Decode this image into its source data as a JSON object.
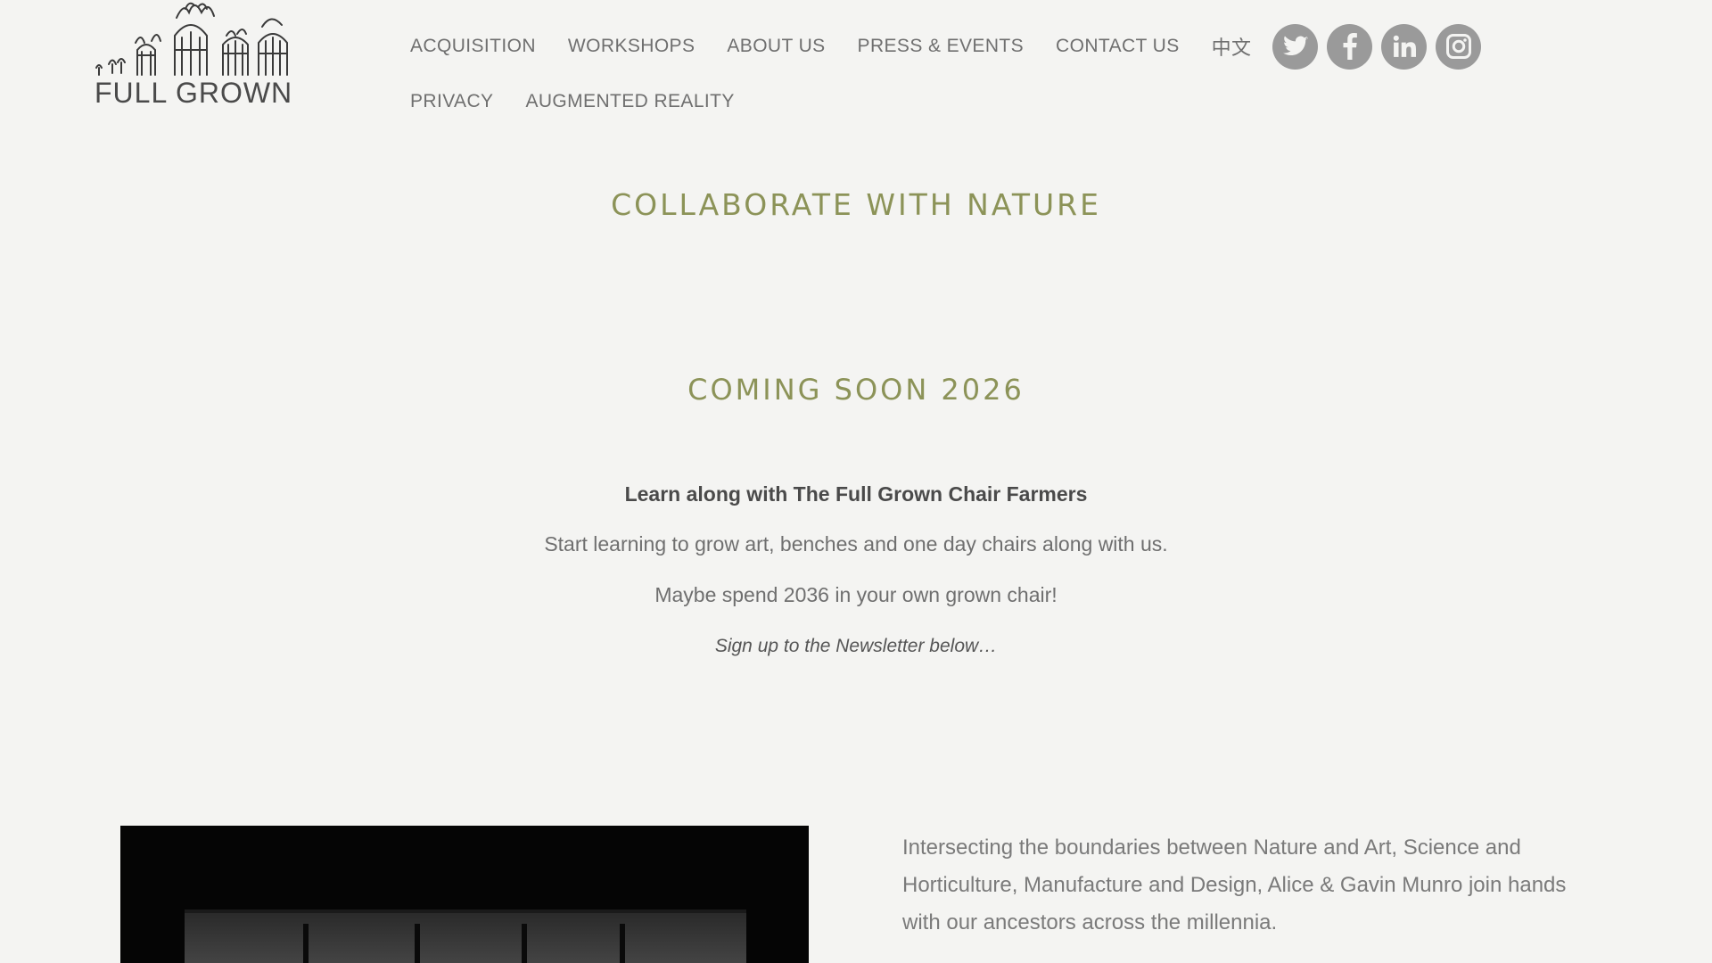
{
  "brand": {
    "logo_text": "FULL GROWN"
  },
  "nav": {
    "row1": [
      "ACQUISITION",
      "WORKSHOPS",
      "ABOUT US",
      "PRESS & EVENTS",
      "CONTACT US"
    ],
    "lang": "中文",
    "row2": [
      "PRIVACY",
      "AUGMENTED REALITY"
    ]
  },
  "social": [
    {
      "icon": "twitter-icon"
    },
    {
      "icon": "facebook-icon"
    },
    {
      "icon": "linkedin-icon"
    },
    {
      "icon": "instagram-icon"
    }
  ],
  "main": {
    "headline": "COLLABORATE WITH NATURE",
    "coming_soon": "COMING SOON 2026",
    "learn_title": "Learn along with The Full Grown Chair Farmers",
    "learn_line1": "Start learning to grow art, benches and one day chairs along with us.",
    "learn_line2": "Maybe spend 2036 in your own grown chair!",
    "signup_note": "Sign up to the Newsletter below…"
  },
  "intro": {
    "text": "Intersecting the boundaries between Nature and Art, Science and Horticulture, Manufacture and Design, Alice & Gavin Munro join hands with our ancestors across the millennia."
  },
  "colors": {
    "background": "#f4f4f2",
    "accent_olive": "#8c9358",
    "social_grey": "#9a9a9a",
    "text_grey": "#6f6f6f"
  }
}
